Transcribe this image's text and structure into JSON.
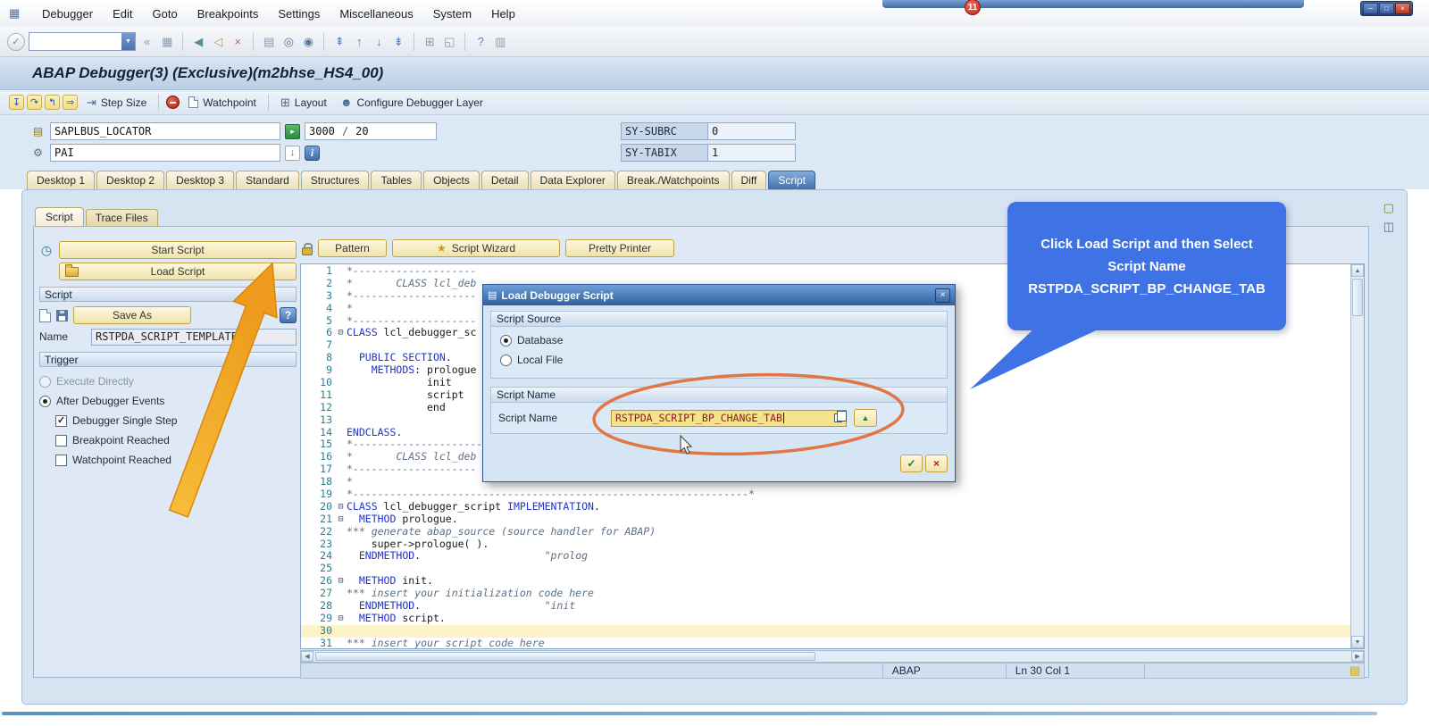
{
  "window": {
    "badge": "11",
    "controls": [
      {
        "name": "minimize-button",
        "glyph": "─"
      },
      {
        "name": "maximize-button",
        "glyph": "□"
      },
      {
        "name": "close-button",
        "glyph": "×"
      }
    ]
  },
  "menubar": {
    "items": [
      "Debugger",
      "Edit",
      "Goto",
      "Breakpoints",
      "Settings",
      "Miscellaneous",
      "System",
      "Help"
    ]
  },
  "toolbar": {
    "command_value": "",
    "icons": [
      {
        "name": "save-icon",
        "glyph": "▦",
        "color": "#8b9cb2"
      },
      {
        "sep": true
      },
      {
        "name": "back-icon",
        "glyph": "◀",
        "color": "#56909f"
      },
      {
        "name": "exit-icon",
        "glyph": "◁",
        "color": "#b09a4a"
      },
      {
        "name": "cancel-icon",
        "glyph": "×",
        "color": "#b06a6a"
      },
      {
        "sep": true
      },
      {
        "name": "print-icon",
        "glyph": "▤",
        "color": "#8b9cb2"
      },
      {
        "name": "find-icon",
        "glyph": "◎",
        "color": "#56789f"
      },
      {
        "name": "find-next-icon",
        "glyph": "◉",
        "color": "#56789f"
      },
      {
        "sep": true
      },
      {
        "name": "first-page-icon",
        "glyph": "⇞",
        "color": "#5b82b4"
      },
      {
        "name": "prev-page-icon",
        "glyph": "↑",
        "color": "#5b82b4"
      },
      {
        "name": "next-page-icon",
        "glyph": "↓",
        "color": "#5b82b4"
      },
      {
        "name": "last-page-icon",
        "glyph": "⇟",
        "color": "#5b82b4"
      },
      {
        "sep": true
      },
      {
        "name": "new-session-icon",
        "glyph": "⊞",
        "color": "#8b9cb2"
      },
      {
        "name": "shortcut-icon",
        "glyph": "◱",
        "color": "#8b9cb2"
      },
      {
        "sep": true
      },
      {
        "name": "help-icon",
        "glyph": "?",
        "color": "#5b82b4"
      },
      {
        "name": "gui-settings-icon",
        "glyph": "▥",
        "color": "#8b9cb2"
      }
    ]
  },
  "title": "ABAP Debugger(3)  (Exclusive)(m2bhse_HS4_00)",
  "app_toolbar": {
    "step_icons": [
      {
        "name": "step-into-icon",
        "glyph": "↧"
      },
      {
        "name": "step-over-icon",
        "glyph": "↷"
      },
      {
        "name": "step-return-icon",
        "glyph": "↰"
      },
      {
        "name": "continue-icon",
        "glyph": "⇒"
      }
    ],
    "step_size_label": "Step Size",
    "watchpoint_label": "Watchpoint",
    "layout_label": "Layout",
    "configure_label": "Configure Debugger Layer"
  },
  "context": {
    "program": "SAPLBUS_LOCATOR",
    "line": "3000",
    "line_total": "20",
    "event": "PAI",
    "sy_subrc_label": "SY-SUBRC",
    "sy_subrc_value": "0",
    "sy_tabix_label": "SY-TABIX",
    "sy_tabix_value": "1"
  },
  "tabs": {
    "items": [
      "Desktop 1",
      "Desktop 2",
      "Desktop 3",
      "Standard",
      "Structures",
      "Tables",
      "Objects",
      "Detail",
      "Data Explorer",
      "Break./Watchpoints",
      "Diff",
      "Script"
    ],
    "active": "Script"
  },
  "subtabs": {
    "items": [
      "Script",
      "Trace Files"
    ],
    "active": "Script"
  },
  "left_panel": {
    "start_script_label": "Start Script",
    "load_script_label": "Load Script",
    "script_header": "Script",
    "save_as_label": "Save As",
    "name_label": "Name",
    "name_value": "RSTPDA_SCRIPT_TEMPLATE",
    "trigger_header": "Trigger",
    "trigger_options": [
      {
        "label": "Execute Directly",
        "control": "radio",
        "checked": false,
        "enabled": false,
        "indent": 0
      },
      {
        "label": "After Debugger Events",
        "control": "radio",
        "checked": true,
        "enabled": true,
        "indent": 0
      },
      {
        "label": "Debugger Single Step",
        "control": "checkbox",
        "checked": true,
        "enabled": true,
        "indent": 1
      },
      {
        "label": "Breakpoint Reached",
        "control": "checkbox",
        "checked": false,
        "enabled": true,
        "indent": 1
      },
      {
        "label": "Watchpoint Reached",
        "control": "checkbox",
        "checked": false,
        "enabled": true,
        "indent": 1
      }
    ]
  },
  "editor": {
    "toolbar": {
      "pattern_label": "Pattern",
      "wizard_label": "Script Wizard",
      "pretty_label": "Pretty Printer"
    },
    "current_line": 30,
    "lines": [
      {
        "n": 1,
        "text": "*--------------------"
      },
      {
        "n": 2,
        "text": "*       CLASS lcl_deb"
      },
      {
        "n": 3,
        "text": "*--------------------"
      },
      {
        "n": 4,
        "text": "*"
      },
      {
        "n": 5,
        "text": "*--------------------"
      },
      {
        "n": 6,
        "text": "CLASS lcl_debugger_sc",
        "fold": true
      },
      {
        "n": 7,
        "text": ""
      },
      {
        "n": 8,
        "text": "  PUBLIC SECTION."
      },
      {
        "n": 9,
        "text": "    METHODS: prologue"
      },
      {
        "n": 10,
        "text": "             init"
      },
      {
        "n": 11,
        "text": "             script"
      },
      {
        "n": 12,
        "text": "             end"
      },
      {
        "n": 13,
        "text": ""
      },
      {
        "n": 14,
        "text": "ENDCLASS."
      },
      {
        "n": 15,
        "text": "*----------------------------------------------------------------*"
      },
      {
        "n": 16,
        "text": "*       CLASS lcl_deb"
      },
      {
        "n": 17,
        "text": "*--------------------"
      },
      {
        "n": 18,
        "text": "*"
      },
      {
        "n": 19,
        "text": "*----------------------------------------------------------------*"
      },
      {
        "n": 20,
        "text": "CLASS lcl_debugger_script IMPLEMENTATION.",
        "fold": true
      },
      {
        "n": 21,
        "text": "  METHOD prologue.",
        "fold": true
      },
      {
        "n": 22,
        "text": "*** generate abap_source (source handler for ABAP)"
      },
      {
        "n": 23,
        "text": "    super->prologue( )."
      },
      {
        "n": 24,
        "text": "  ENDMETHOD.                    \"prolog"
      },
      {
        "n": 25,
        "text": ""
      },
      {
        "n": 26,
        "text": "  METHOD init.",
        "fold": true
      },
      {
        "n": 27,
        "text": "*** insert your initialization code here"
      },
      {
        "n": 28,
        "text": "  ENDMETHOD.                    \"init"
      },
      {
        "n": 29,
        "text": "  METHOD script.",
        "fold": true
      },
      {
        "n": 30,
        "text": ""
      },
      {
        "n": 31,
        "text": "*** insert your script code here"
      }
    ]
  },
  "statusbar": {
    "language": "ABAP",
    "position": "Ln  30 Col  1"
  },
  "dialog": {
    "title": "Load Debugger Script",
    "source_header": "Script Source",
    "source_options": [
      {
        "label": "Database",
        "checked": true
      },
      {
        "label": "Local File",
        "checked": false
      }
    ],
    "name_header": "Script Name",
    "name_label": "Script Name",
    "name_value": "RSTPDA_SCRIPT_BP_CHANGE_TAB"
  },
  "callout": {
    "text": "Click Load Script and then Select Script Name RSTPDA_SCRIPT_BP_CHANGE_TAB"
  },
  "icons": {
    "system_menu": "▦",
    "enter": "✓",
    "dropdown": "▼",
    "collapse": "«",
    "step_size": "⇥",
    "layout": "⊞",
    "person": "☻",
    "program": "▤",
    "position": "▸",
    "event": "⚙",
    "jump": "↓",
    "info": "i",
    "start": "◷",
    "wizard": "★",
    "help": "?",
    "dialog_window": "▤",
    "close": "×",
    "browse": "▲",
    "ok": "✓",
    "cancel": "×",
    "scroll_up": "▲",
    "scroll_down": "▼",
    "scroll_left": "◀",
    "scroll_right": "▶",
    "panel_page": "▢",
    "panel_layout": "◫",
    "note": "▤"
  },
  "colors": {
    "callout_blue": "#3f72e4",
    "annotation_orange": "#e0703c",
    "arrow_yellow": "#f3a82c"
  }
}
